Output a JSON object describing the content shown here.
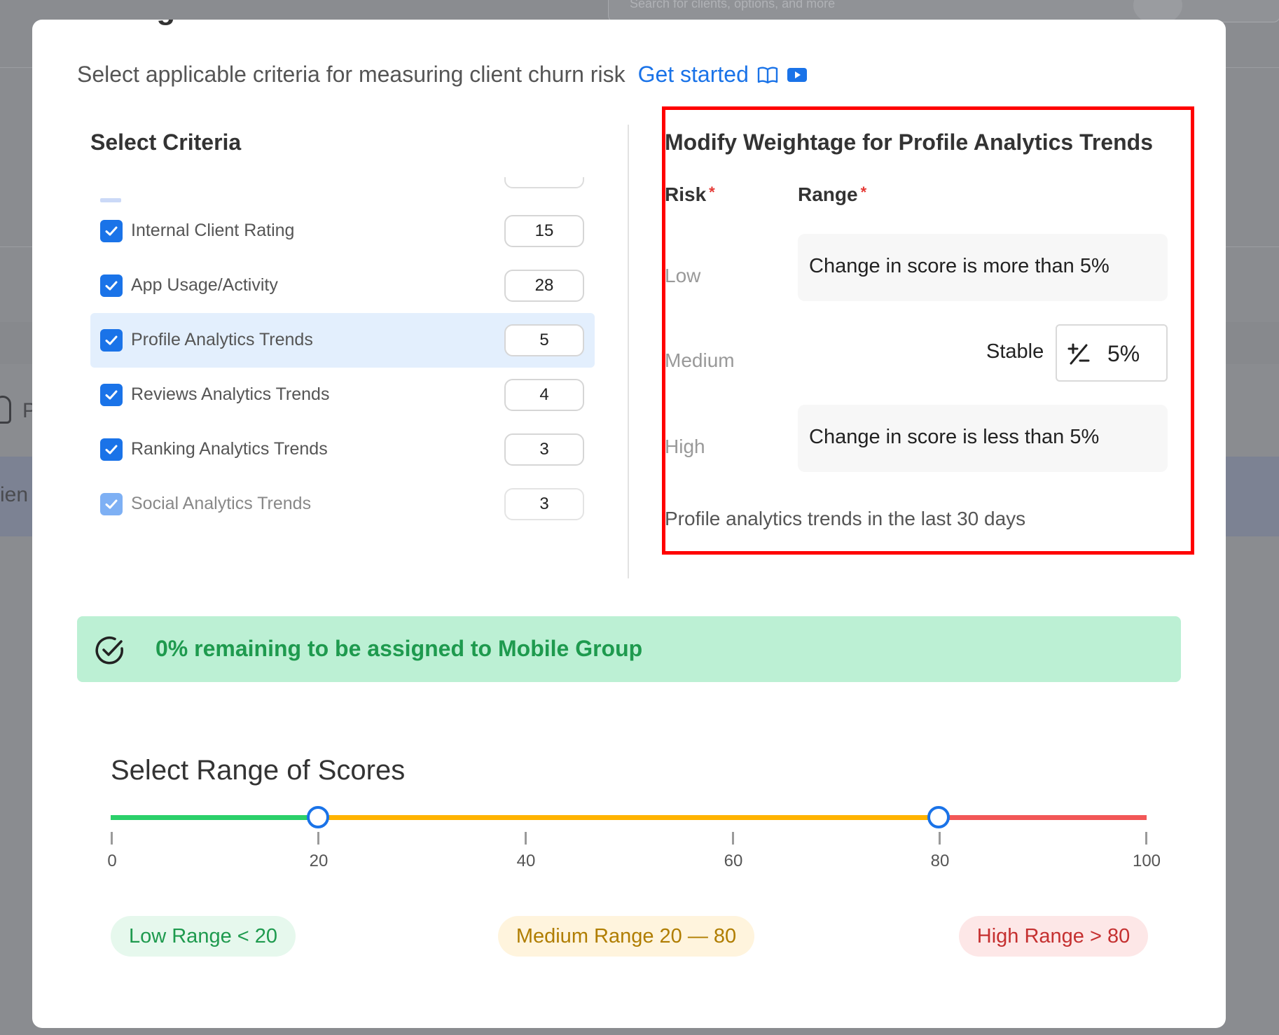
{
  "background": {
    "search_placeholder": "Search for clients, options, and more",
    "side_text_1": "P",
    "side_text_2": "ien"
  },
  "modal": {
    "title": "Configure churn risk criteria",
    "subtitle": "Select applicable criteria for measuring client churn risk",
    "get_started_link": "Get started",
    "icons": [
      "book-open-icon",
      "play-video-icon"
    ]
  },
  "criteria": {
    "title": "Select Criteria",
    "items": [
      {
        "label": "Internal Client Rating",
        "value": "15",
        "checked": true,
        "selected": false
      },
      {
        "label": "App Usage/Activity",
        "value": "28",
        "checked": true,
        "selected": false
      },
      {
        "label": "Profile Analytics Trends",
        "value": "5",
        "checked": true,
        "selected": true
      },
      {
        "label": "Reviews Analytics Trends",
        "value": "4",
        "checked": true,
        "selected": false
      },
      {
        "label": "Ranking Analytics Trends",
        "value": "3",
        "checked": true,
        "selected": false
      },
      {
        "label": "Social Analytics Trends",
        "value": "3",
        "checked": true,
        "selected": false,
        "disabled": true
      }
    ]
  },
  "weightage": {
    "title": "Modify Weightage for Profile Analytics Trends",
    "risk_header": "Risk",
    "range_header": "Range",
    "required_mark": "*",
    "rows": {
      "low": {
        "risk": "Low",
        "range": "Change in score is more than 5%"
      },
      "medium": {
        "risk": "Medium",
        "range_label": "Stable",
        "value": "5%"
      },
      "high": {
        "risk": "High",
        "range": "Change in score is less than 5%"
      }
    },
    "note": "Profile analytics trends in the last 30 days"
  },
  "banner": {
    "text": "0% remaining to be assigned to Mobile Group",
    "color": "#1e9a4e"
  },
  "score_range": {
    "title": "Select Range of Scores",
    "min": 0,
    "max": 100,
    "thumbs": [
      20,
      80
    ],
    "ticks": [
      "0",
      "20",
      "40",
      "60",
      "80",
      "100"
    ],
    "segment_colors": {
      "low": "#2bd06a",
      "medium": "#ffb300",
      "high": "#f25757"
    },
    "pills": {
      "low": "Low Range < 20",
      "medium": "Medium Range 20 — 80",
      "high": "High Range > 80"
    }
  }
}
